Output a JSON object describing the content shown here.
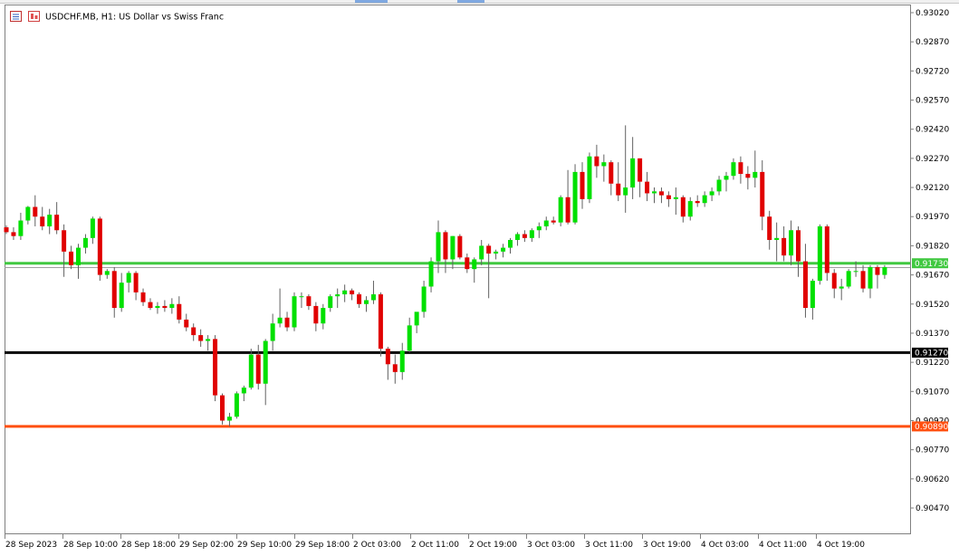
{
  "chart_title": "USDCHF.MB, H1:  US Dollar vs Swiss Franc",
  "icons": [
    "chart-properties-icon",
    "trading-signals-icon"
  ],
  "colors": {
    "bull": "#00e000",
    "bear": "#e00000",
    "wick": "#606060",
    "green_line": "#40c840",
    "black_line": "#000000",
    "orange_line": "#ff4f0f",
    "grey_line": "#a0a0a0"
  },
  "chart_data": {
    "type": "candlestick",
    "symbol": "USDCHF.MB",
    "timeframe": "H1",
    "ylim": [
      0.9034,
      0.9305
    ],
    "y_ticks": [
      "0.93020",
      "0.92870",
      "0.92720",
      "0.92570",
      "0.92420",
      "0.92270",
      "0.92120",
      "0.91970",
      "0.91820",
      "0.91670",
      "0.91520",
      "0.91370",
      "0.91220",
      "0.91070",
      "0.90920",
      "0.90770",
      "0.90620",
      "0.90470"
    ],
    "x_labels": [
      "28 Sep 2023",
      "28 Sep 10:00",
      "28 Sep 18:00",
      "29 Sep 02:00",
      "29 Sep 10:00",
      "29 Sep 18:00",
      "2 Oct 03:00",
      "2 Oct 11:00",
      "2 Oct 19:00",
      "3 Oct 03:00",
      "3 Oct 11:00",
      "3 Oct 19:00",
      "4 Oct 03:00",
      "4 Oct 11:00",
      "4 Oct 19:00"
    ],
    "horizontal_lines": [
      {
        "label": "0.91730",
        "value": 0.9173,
        "color": "green"
      },
      {
        "label": "0.91270",
        "value": 0.9127,
        "color": "black"
      },
      {
        "label": "0.90890",
        "value": 0.9089,
        "color": "orange"
      }
    ],
    "bid_line": 0.9171,
    "candles": [
      [
        0.91915,
        0.91925,
        0.9188,
        0.9189
      ],
      [
        0.9189,
        0.91915,
        0.9185,
        0.9187
      ],
      [
        0.9187,
        0.9199,
        0.9185,
        0.9195
      ],
      [
        0.9195,
        0.92025,
        0.9193,
        0.9202
      ],
      [
        0.9202,
        0.9208,
        0.9192,
        0.9197
      ],
      [
        0.9197,
        0.9202,
        0.919,
        0.9192
      ],
      [
        0.9192,
        0.9201,
        0.9188,
        0.9198
      ],
      [
        0.9198,
        0.92045,
        0.9188,
        0.919
      ],
      [
        0.919,
        0.9193,
        0.9166,
        0.9179
      ],
      [
        0.9179,
        0.9182,
        0.917,
        0.9172
      ],
      [
        0.9172,
        0.9183,
        0.9165,
        0.9181
      ],
      [
        0.9181,
        0.9188,
        0.9178,
        0.9186
      ],
      [
        0.9186,
        0.9197,
        0.9183,
        0.9196
      ],
      [
        0.9196,
        0.9197,
        0.9164,
        0.9167
      ],
      [
        0.9167,
        0.917,
        0.9165,
        0.9169
      ],
      [
        0.9169,
        0.9171,
        0.9145,
        0.915
      ],
      [
        0.915,
        0.9168,
        0.9148,
        0.9163
      ],
      [
        0.9163,
        0.9169,
        0.9158,
        0.9168
      ],
      [
        0.9168,
        0.9169,
        0.9154,
        0.9158
      ],
      [
        0.9158,
        0.916,
        0.9151,
        0.9153
      ],
      [
        0.9153,
        0.9155,
        0.9149,
        0.915
      ],
      [
        0.915,
        0.9153,
        0.9147,
        0.9151
      ],
      [
        0.9151,
        0.9154,
        0.9148,
        0.915
      ],
      [
        0.915,
        0.9155,
        0.9147,
        0.9152
      ],
      [
        0.9152,
        0.9156,
        0.9142,
        0.9144
      ],
      [
        0.9144,
        0.9147,
        0.9138,
        0.914
      ],
      [
        0.914,
        0.9142,
        0.9133,
        0.9136
      ],
      [
        0.9136,
        0.9139,
        0.913,
        0.9133
      ],
      [
        0.9133,
        0.9136,
        0.9128,
        0.9134
      ],
      [
        0.9134,
        0.9136,
        0.9102,
        0.9105
      ],
      [
        0.9105,
        0.9106,
        0.909,
        0.9092
      ],
      [
        0.9092,
        0.9096,
        0.9089,
        0.9094
      ],
      [
        0.9094,
        0.9107,
        0.9093,
        0.9106
      ],
      [
        0.9106,
        0.911,
        0.9102,
        0.9109
      ],
      [
        0.9109,
        0.9129,
        0.9108,
        0.9126
      ],
      [
        0.9126,
        0.9131,
        0.9108,
        0.9111
      ],
      [
        0.9111,
        0.9134,
        0.91,
        0.9133
      ],
      [
        0.9133,
        0.9147,
        0.9128,
        0.9142
      ],
      [
        0.9142,
        0.916,
        0.914,
        0.9145
      ],
      [
        0.9145,
        0.9148,
        0.9138,
        0.914
      ],
      [
        0.914,
        0.9158,
        0.9138,
        0.9156
      ],
      [
        0.9156,
        0.9158,
        0.915,
        0.9156
      ],
      [
        0.9156,
        0.9157,
        0.9149,
        0.9151
      ],
      [
        0.9151,
        0.9153,
        0.9138,
        0.9142
      ],
      [
        0.9142,
        0.9152,
        0.9139,
        0.915
      ],
      [
        0.915,
        0.9157,
        0.9148,
        0.9156
      ],
      [
        0.9156,
        0.916,
        0.915,
        0.9157
      ],
      [
        0.9157,
        0.9162,
        0.9153,
        0.9159
      ],
      [
        0.9159,
        0.916,
        0.9154,
        0.9157
      ],
      [
        0.9157,
        0.9158,
        0.915,
        0.9152
      ],
      [
        0.9152,
        0.9156,
        0.9148,
        0.9154
      ],
      [
        0.9154,
        0.9164,
        0.9152,
        0.9157
      ],
      [
        0.9157,
        0.9158,
        0.9125,
        0.9129
      ],
      [
        0.9129,
        0.913,
        0.9113,
        0.9121
      ],
      [
        0.9121,
        0.9126,
        0.9111,
        0.9117
      ],
      [
        0.9117,
        0.9132,
        0.9113,
        0.9128
      ],
      [
        0.9128,
        0.9145,
        0.9127,
        0.9141
      ],
      [
        0.9141,
        0.9147,
        0.9137,
        0.9148
      ],
      [
        0.9148,
        0.9164,
        0.9145,
        0.9161
      ],
      [
        0.9161,
        0.9176,
        0.9158,
        0.9174
      ],
      [
        0.9174,
        0.9195,
        0.9168,
        0.9189
      ],
      [
        0.9189,
        0.919,
        0.9168,
        0.9175
      ],
      [
        0.9175,
        0.9187,
        0.917,
        0.9187
      ],
      [
        0.9187,
        0.9188,
        0.9175,
        0.9176
      ],
      [
        0.9176,
        0.9178,
        0.9168,
        0.917
      ],
      [
        0.917,
        0.9176,
        0.9163,
        0.9175
      ],
      [
        0.9175,
        0.9185,
        0.9172,
        0.9182
      ],
      [
        0.9182,
        0.9183,
        0.9155,
        0.9178
      ],
      [
        0.9178,
        0.918,
        0.9175,
        0.9179
      ],
      [
        0.9179,
        0.9183,
        0.9176,
        0.9181
      ],
      [
        0.9181,
        0.9186,
        0.9178,
        0.9185
      ],
      [
        0.9185,
        0.9189,
        0.9182,
        0.9188
      ],
      [
        0.9188,
        0.919,
        0.9184,
        0.9186
      ],
      [
        0.9186,
        0.9191,
        0.9184,
        0.919
      ],
      [
        0.919,
        0.9194,
        0.9186,
        0.9192
      ],
      [
        0.9192,
        0.9197,
        0.919,
        0.9195
      ],
      [
        0.9195,
        0.9197,
        0.9193,
        0.9194
      ],
      [
        0.9194,
        0.9208,
        0.9192,
        0.9207
      ],
      [
        0.9207,
        0.9221,
        0.9193,
        0.9194
      ],
      [
        0.9194,
        0.9224,
        0.9193,
        0.922
      ],
      [
        0.922,
        0.9225,
        0.9201,
        0.9206
      ],
      [
        0.9206,
        0.923,
        0.9204,
        0.9228
      ],
      [
        0.9228,
        0.9234,
        0.9217,
        0.9223
      ],
      [
        0.9223,
        0.9229,
        0.9215,
        0.9225
      ],
      [
        0.9225,
        0.9226,
        0.9208,
        0.9214
      ],
      [
        0.9214,
        0.9225,
        0.9205,
        0.9208
      ],
      [
        0.9208,
        0.9244,
        0.9199,
        0.9212
      ],
      [
        0.9212,
        0.9238,
        0.9206,
        0.9227
      ],
      [
        0.9227,
        0.9227,
        0.9207,
        0.9215
      ],
      [
        0.9215,
        0.922,
        0.9205,
        0.9209
      ],
      [
        0.9209,
        0.9212,
        0.9204,
        0.921
      ],
      [
        0.921,
        0.9212,
        0.9204,
        0.9208
      ],
      [
        0.9208,
        0.921,
        0.9202,
        0.9206
      ],
      [
        0.9206,
        0.9212,
        0.9198,
        0.9207
      ],
      [
        0.9207,
        0.9208,
        0.9194,
        0.9197
      ],
      [
        0.9197,
        0.9207,
        0.9195,
        0.9205
      ],
      [
        0.9205,
        0.9208,
        0.9202,
        0.9204
      ],
      [
        0.9204,
        0.921,
        0.9202,
        0.9208
      ],
      [
        0.9208,
        0.9212,
        0.9205,
        0.921
      ],
      [
        0.921,
        0.9218,
        0.9208,
        0.9216
      ],
      [
        0.9216,
        0.922,
        0.921,
        0.9218
      ],
      [
        0.9218,
        0.9227,
        0.9216,
        0.9225
      ],
      [
        0.9225,
        0.9228,
        0.9214,
        0.9219
      ],
      [
        0.9219,
        0.9223,
        0.9211,
        0.9217
      ],
      [
        0.9217,
        0.9231,
        0.9212,
        0.922
      ],
      [
        0.922,
        0.9226,
        0.919,
        0.9197
      ],
      [
        0.9197,
        0.92,
        0.918,
        0.9185
      ],
      [
        0.9185,
        0.9194,
        0.9174,
        0.9186
      ],
      [
        0.9186,
        0.9192,
        0.9174,
        0.9177
      ],
      [
        0.9177,
        0.9195,
        0.9172,
        0.919
      ],
      [
        0.919,
        0.9192,
        0.9166,
        0.9174
      ],
      [
        0.9174,
        0.9183,
        0.9145,
        0.915
      ],
      [
        0.915,
        0.9165,
        0.9144,
        0.9164
      ],
      [
        0.9164,
        0.9193,
        0.9162,
        0.9192
      ],
      [
        0.9192,
        0.9193,
        0.9164,
        0.9168
      ],
      [
        0.9168,
        0.917,
        0.9155,
        0.916
      ],
      [
        0.916,
        0.9165,
        0.9154,
        0.9161
      ],
      [
        0.9161,
        0.917,
        0.916,
        0.9169
      ],
      [
        0.9169,
        0.9174,
        0.9166,
        0.9169
      ],
      [
        0.9169,
        0.9172,
        0.9158,
        0.916
      ],
      [
        0.916,
        0.9172,
        0.9155,
        0.9171
      ],
      [
        0.9171,
        0.9172,
        0.916,
        0.9167
      ],
      [
        0.9167,
        0.9172,
        0.9165,
        0.9171
      ]
    ]
  }
}
